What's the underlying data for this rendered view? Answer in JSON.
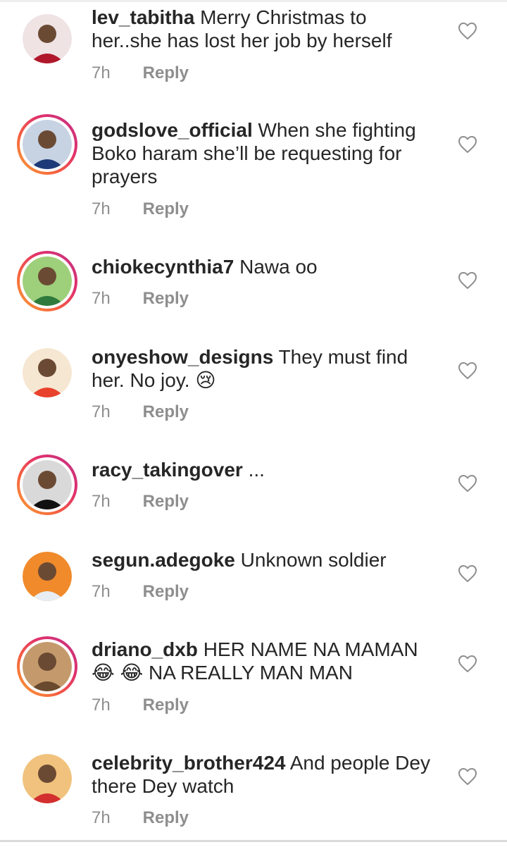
{
  "comments": [
    {
      "username": "lev_tabitha",
      "text": "Merry Christmas to her..she has lost her job by herself",
      "time": "7h",
      "reply": "Reply",
      "story_ring": false,
      "avatar_colors": [
        "#b0172a",
        "#efe3e4"
      ]
    },
    {
      "username": "godslove_official",
      "text": "When she fighting Boko haram she’ll be requesting for prayers",
      "time": "7h",
      "reply": "Reply",
      "story_ring": true,
      "avatar_colors": [
        "#1f3a78",
        "#c7d3e3"
      ]
    },
    {
      "username": "chiokecynthia7",
      "text": "Nawa oo",
      "time": "7h",
      "reply": "Reply",
      "story_ring": true,
      "avatar_colors": [
        "#2f7a3c",
        "#9ecf7a"
      ]
    },
    {
      "username": "onyeshow_designs",
      "text": "They must find her. No joy. 😢",
      "time": "7h",
      "reply": "Reply",
      "story_ring": false,
      "avatar_colors": [
        "#e8412c",
        "#f6e7d2"
      ]
    },
    {
      "username": "racy_takingover",
      "text": "...",
      "time": "7h",
      "reply": "Reply",
      "story_ring": true,
      "avatar_colors": [
        "#111111",
        "#d9d9d9"
      ]
    },
    {
      "username": "segun.adegoke",
      "text": "Unknown soldier",
      "time": "7h",
      "reply": "Reply",
      "story_ring": false,
      "avatar_colors": [
        "#e7edf2",
        "#f08a2b"
      ]
    },
    {
      "username": "driano_dxb",
      "text": "HER NAME NA MAMAN 😂 😂 NA REALLY MAN MAN",
      "time": "7h",
      "reply": "Reply",
      "story_ring": true,
      "avatar_colors": [
        "#6a4a2e",
        "#c49a6c"
      ]
    },
    {
      "username": "celebrity_brother424",
      "text": "And people Dey there Dey watch",
      "time": "7h",
      "reply": "Reply",
      "story_ring": false,
      "avatar_colors": [
        "#d32f2f",
        "#f1c27d"
      ]
    }
  ],
  "icons": {
    "avatar": "profile-photo",
    "like": "heart-outline-icon"
  },
  "colors": {
    "text": "#262626",
    "meta": "#8e8e8e",
    "ring_start": "#f9a334",
    "ring_end": "#c13584"
  }
}
